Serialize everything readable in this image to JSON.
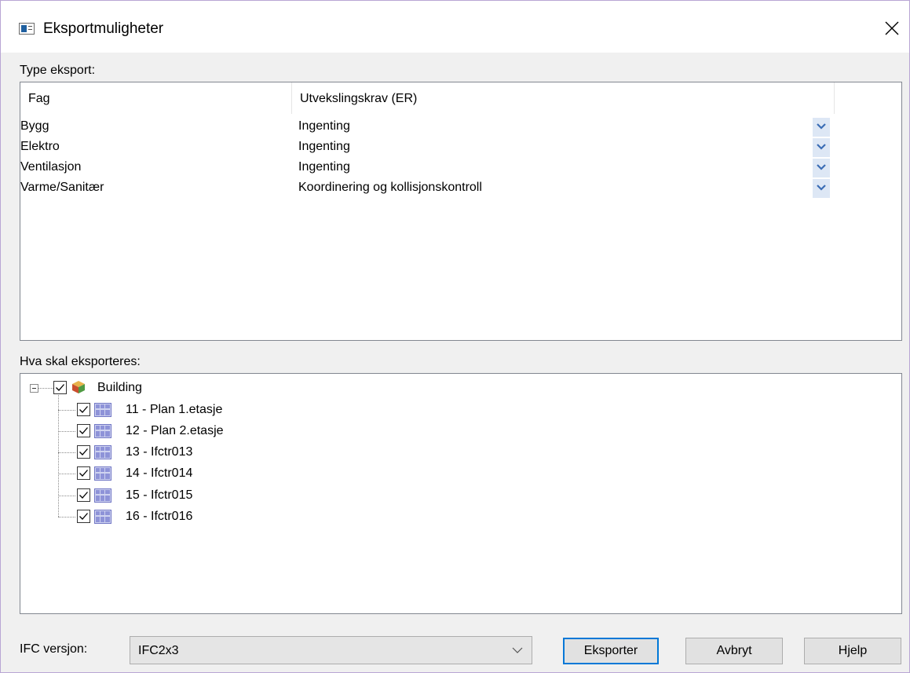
{
  "window": {
    "title": "Eksportmuligheter",
    "close_icon": "close-icon"
  },
  "export_type": {
    "label": "Type eksport:",
    "columns": [
      "Fag",
      "Utvekslingskrav (ER)"
    ],
    "rows": [
      {
        "discipline": "Bygg",
        "requirement": "Ingenting"
      },
      {
        "discipline": "Elektro",
        "requirement": "Ingenting"
      },
      {
        "discipline": "Ventilasjon",
        "requirement": "Ingenting"
      },
      {
        "discipline": "Varme/Sanitær",
        "requirement": "Koordinering og kollisjonskontroll"
      }
    ]
  },
  "what_to_export": {
    "label": "Hva skal eksporteres:",
    "root": {
      "label": "Building",
      "checked": true,
      "expanded": true,
      "icon": "building-icon"
    },
    "children": [
      {
        "label": "11 - Plan 1.etasje",
        "checked": true,
        "icon": "floor-plan-icon"
      },
      {
        "label": "12 - Plan 2.etasje",
        "checked": true,
        "icon": "floor-plan-icon"
      },
      {
        "label": "13 - Ifctr013",
        "checked": true,
        "icon": "floor-plan-icon"
      },
      {
        "label": "14 - Ifctr014",
        "checked": true,
        "icon": "floor-plan-icon"
      },
      {
        "label": "15 - Ifctr015",
        "checked": true,
        "icon": "floor-plan-icon"
      },
      {
        "label": "16 - Ifctr016",
        "checked": true,
        "icon": "floor-plan-icon"
      }
    ]
  },
  "footer": {
    "ifc_version_label": "IFC versjon:",
    "ifc_version_value": "IFC2x3",
    "export_button": "Eksporter",
    "cancel_button": "Avbryt",
    "help_button": "Hjelp"
  },
  "colors": {
    "accent": "#0078d7",
    "dropdown_button_bg": "#dde7f5",
    "dialog_bg": "#f0f0f0",
    "window_border": "#b9a6d4"
  }
}
